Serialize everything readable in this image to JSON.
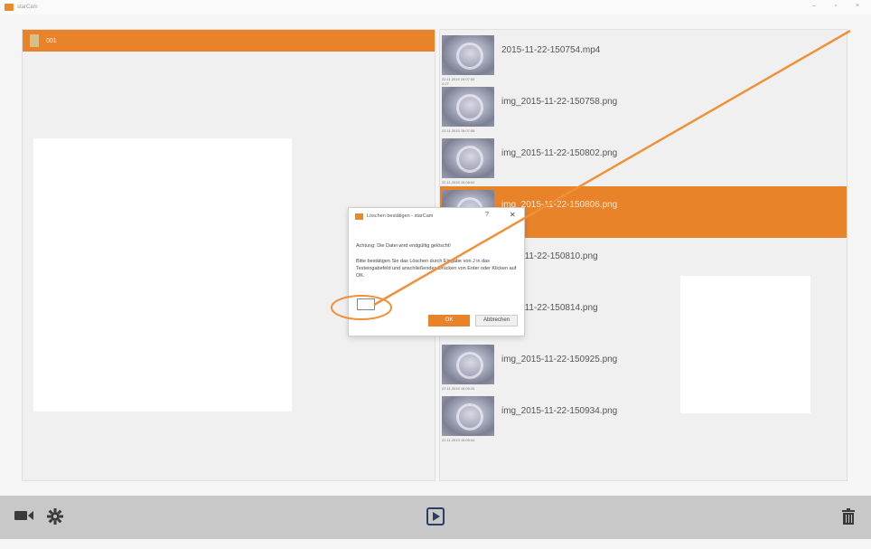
{
  "window": {
    "title": "starCam",
    "controls": {
      "minimize": "–",
      "maximize": "▫",
      "close": "×"
    }
  },
  "left_panel": {
    "folder": {
      "name": "001"
    }
  },
  "files": [
    {
      "name": "2015-11-22-150754.mp4",
      "date": "22.11.2015 15:07:54",
      "duration": "0:27",
      "selected": false
    },
    {
      "name": "img_2015-11-22-150758.png",
      "date": "22.11.2015 15:07:58",
      "selected": false
    },
    {
      "name": "img_2015-11-22-150802.png",
      "date": "22.11.2015 15:08:02",
      "selected": false
    },
    {
      "name": "img_2015-11-22-150806.png",
      "date": "",
      "selected": true
    },
    {
      "name": "2015-11-22-150810.png",
      "date": "",
      "selected": false
    },
    {
      "name": "2015-11-22-150814.png",
      "date": "",
      "selected": false
    },
    {
      "name": "img_2015-11-22-150925.png",
      "date": "22.11.2015 15:09:25",
      "selected": false
    },
    {
      "name": "img_2015-11-22-150934.png",
      "date": "22.11.2015 15:09:34",
      "selected": false
    }
  ],
  "dialog": {
    "title": "Löschen bestätigen - starCam",
    "help": "?",
    "close": "✕",
    "warning": "Achtung: Die Datei wird endgültig gelöscht!",
    "instruction": "Bitte bestätigen Sie das Löschen durch Eingabe von J in das Texteingabefeld und anschließendes Drücken von Enter oder Klicken auf OK.",
    "input_value": "",
    "ok_label": "OK",
    "cancel_label": "Abbrechen"
  },
  "colors": {
    "accent": "#e8832a",
    "annotation": "#f0913a",
    "bottom_bar": "#c8c8c8"
  },
  "toolbar": {
    "icons": [
      "video-camera-icon",
      "gear-icon",
      "play-icon",
      "trash-icon"
    ]
  }
}
